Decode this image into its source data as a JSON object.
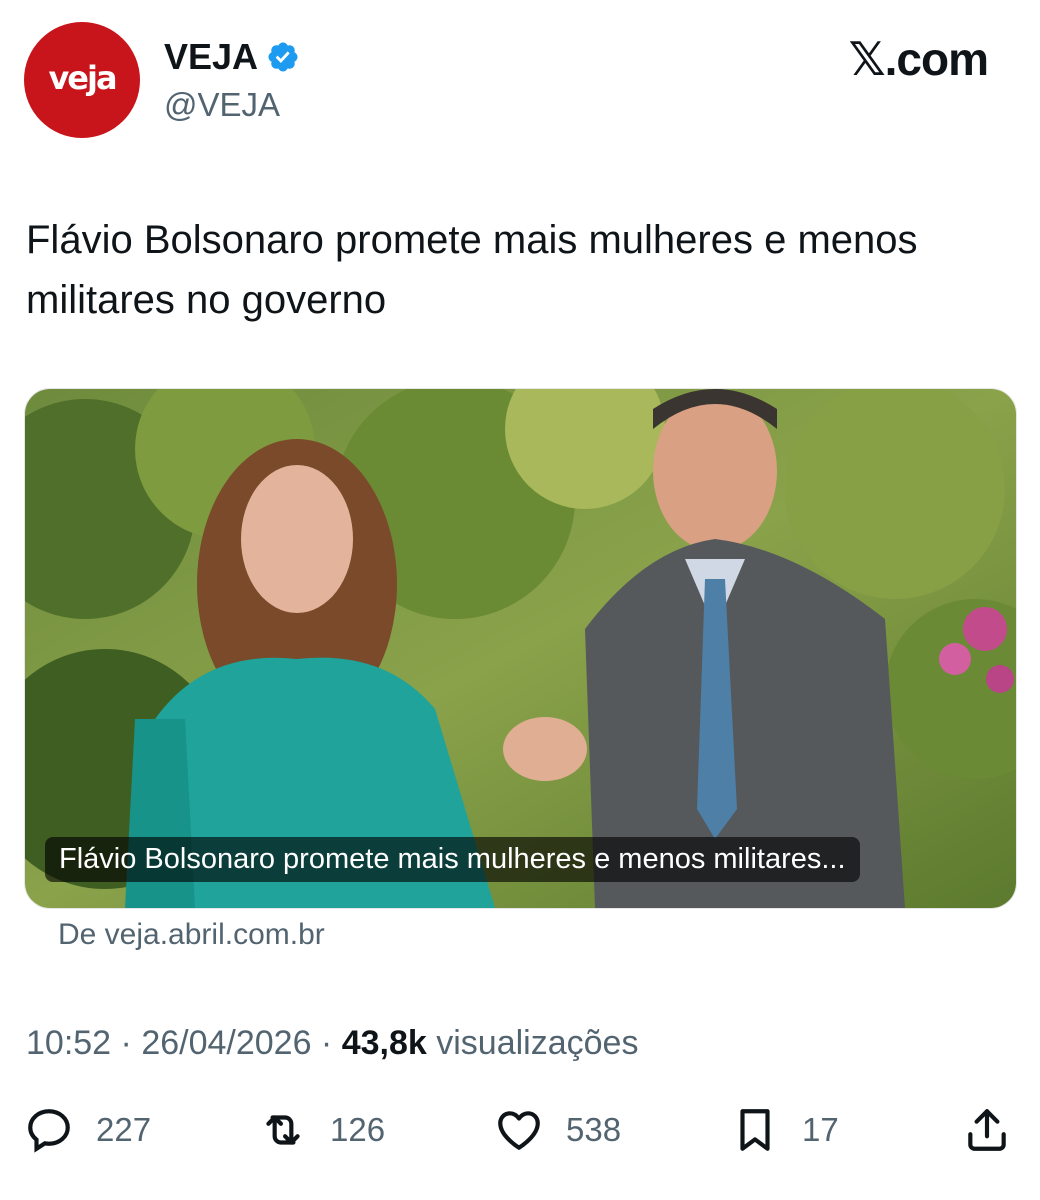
{
  "account": {
    "logo_text": "veja",
    "display_name": "VEJA",
    "handle": "@VEJA",
    "verified": true
  },
  "site_badge": "𝕏.com",
  "tweet": {
    "text": "Flávio Bolsonaro promete mais mulheres e menos militares no governo"
  },
  "link_card": {
    "caption": "Flávio Bolsonaro promete mais mulheres e menos militares...",
    "source": "De veja.abril.com.br"
  },
  "meta": {
    "time": "10:52",
    "sep1": " · ",
    "date": "26/04/2026",
    "sep2": " · ",
    "views_count": "43,8k",
    "views_label": " visualizações"
  },
  "actions": {
    "replies": "227",
    "reposts": "126",
    "likes": "538",
    "bookmarks": "17"
  },
  "colors": {
    "brand_red": "#c8141b",
    "verified_blue": "#1d9bf0",
    "text_primary": "#0f1419",
    "text_secondary": "#536471"
  }
}
